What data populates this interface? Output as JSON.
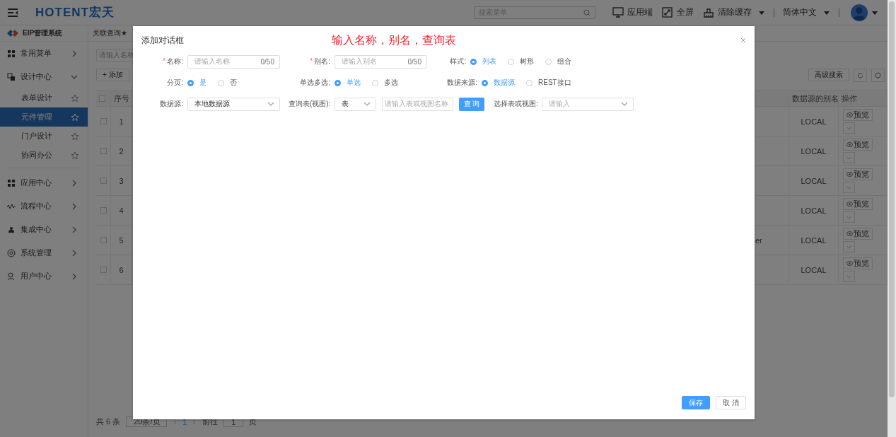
{
  "header": {
    "logo": "HOTENT宏天",
    "search_placeholder": "搜索菜单",
    "actions": [
      {
        "kind": "monitor",
        "label": "应用端",
        "dropdown": false
      },
      {
        "kind": "fullscreen",
        "label": "全屏",
        "dropdown": false
      },
      {
        "kind": "clean",
        "label": "清除缓存",
        "dropdown": true
      }
    ],
    "language": "简体中文"
  },
  "sidebar": {
    "system": "EIP管理系统",
    "groups": [
      {
        "kind": "grid",
        "label": "常用菜单",
        "expanded": false
      },
      {
        "kind": "design",
        "label": "设计中心",
        "expanded": true,
        "children": [
          {
            "label": "表单设计",
            "selected": false
          },
          {
            "label": "元件管理",
            "selected": true
          },
          {
            "label": "门户设计",
            "selected": false
          },
          {
            "label": "协同办公",
            "selected": false
          }
        ]
      },
      {
        "kind": "grid",
        "label": "应用中心",
        "expanded": false
      },
      {
        "kind": "flow",
        "label": "流程中心",
        "expanded": false
      },
      {
        "kind": "integrate",
        "label": "集成中心",
        "expanded": false
      },
      {
        "kind": "system",
        "label": "系统管理",
        "expanded": false
      },
      {
        "kind": "user",
        "label": "用户中心",
        "expanded": false
      }
    ]
  },
  "tab": {
    "label": "关联查询★"
  },
  "toolbar": {
    "search_placeholder": "请输入名称",
    "add": "+ 添加",
    "advanced_search": "高级搜索"
  },
  "table": {
    "header_checked": false,
    "columns": [
      "序号",
      "数据源的别名",
      "操作"
    ],
    "rows": [
      {
        "checked": false,
        "number": "1",
        "column_3": "",
        "alias": "LOCAL",
        "action": "预览"
      },
      {
        "checked": false,
        "number": "2",
        "column_3": "",
        "alias": "LOCAL",
        "action": "预览"
      },
      {
        "checked": false,
        "number": "3",
        "column_3": "",
        "alias": "LOCAL",
        "action": "预览"
      },
      {
        "checked": false,
        "number": "4",
        "column_3": "",
        "alias": "LOCAL",
        "action": "预览"
      },
      {
        "checked": false,
        "number": "5",
        "column_3": "er",
        "alias": "LOCAL",
        "action": "预览"
      },
      {
        "checked": false,
        "number": "6",
        "column_3": "",
        "alias": "LOCAL",
        "action": "预览"
      }
    ]
  },
  "pagination": {
    "total": "共 6 条",
    "page_size": "20条/页",
    "current_page": "1",
    "goto_label": "前往",
    "goto_value": "1",
    "page_unit": "页"
  },
  "dialog": {
    "title": "添加对话框",
    "annotation": "输入名称，别名，查询表",
    "rows": [
      [
        {
          "kind": "text",
          "required_mark": "*",
          "label": "名称:",
          "placeholder": "请输入名称",
          "counter": "0/50"
        },
        {
          "kind": "text",
          "required_mark": "*",
          "label": "别名:",
          "placeholder": "请输入别名",
          "counter": "0/50"
        },
        {
          "kind": "radio",
          "label": "样式:",
          "options": [
            {
              "label": "列表",
              "selected": true
            },
            {
              "label": "树形",
              "selected": false
            },
            {
              "label": "组合",
              "selected": false
            }
          ]
        }
      ],
      [
        {
          "kind": "radio",
          "label": "分页:",
          "options": [
            {
              "label": "是",
              "selected": true
            },
            {
              "label": "否",
              "selected": false
            }
          ]
        },
        {
          "kind": "radio",
          "label": "单选多选:",
          "options": [
            {
              "label": "单选",
              "selected": true
            },
            {
              "label": "多选",
              "selected": false
            }
          ]
        },
        {
          "kind": "radio",
          "label": "数据来源:",
          "options": [
            {
              "label": "数据源",
              "selected": true
            },
            {
              "label": "REST接口",
              "selected": false
            }
          ]
        }
      ],
      [
        {
          "kind": "select",
          "label": "数据源:",
          "value": "本地数据源"
        },
        {
          "kind": "query",
          "label": "查询表(视图):",
          "value": "表",
          "placeholder": "请输入表或视图名称",
          "button": "查 询"
        },
        {
          "kind": "select_wide",
          "label": "选择表或视图:",
          "placeholder": "请输入"
        }
      ]
    ],
    "buttons": [
      {
        "label": "保存",
        "primary": true
      },
      {
        "label": "取 消",
        "primary": false
      }
    ]
  }
}
